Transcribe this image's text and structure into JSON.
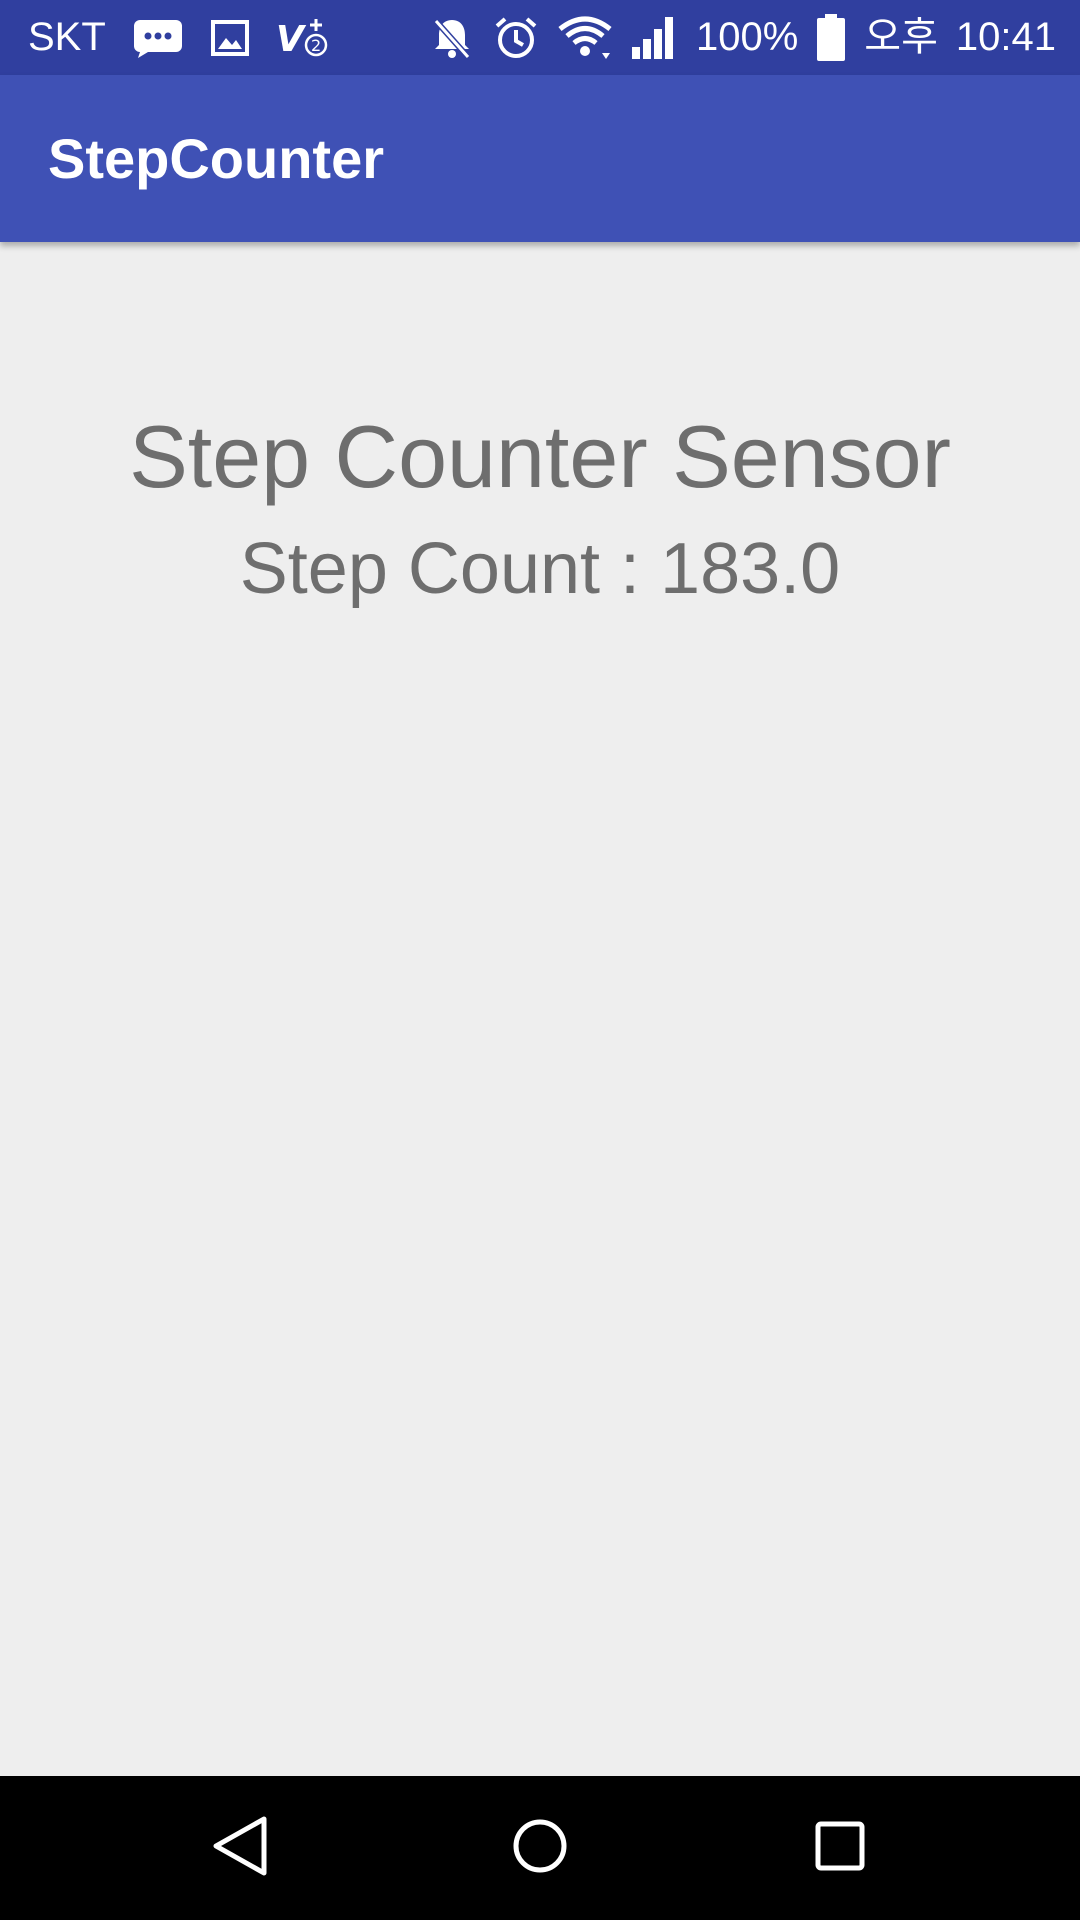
{
  "status_bar": {
    "carrier": "SKT",
    "battery": "100%",
    "time_period": "오후",
    "time": "10:41",
    "icons": [
      "message-icon",
      "image-icon",
      "v-badge-icon",
      "notifications-off-icon",
      "alarm-icon",
      "wifi-icon",
      "signal-icon",
      "battery-icon"
    ]
  },
  "app_bar": {
    "title": "StepCounter"
  },
  "main": {
    "sensor_title": "Step Counter Sensor",
    "step_count": "Step Count : 183.0"
  },
  "nav_bar": {
    "buttons": [
      "back-icon",
      "home-icon",
      "recents-icon"
    ]
  },
  "colors": {
    "status_bar": "#303f9f",
    "app_bar": "#3f51b5",
    "background": "#eeeeee",
    "text": "#6e6e6e",
    "nav_bar": "#000000"
  }
}
